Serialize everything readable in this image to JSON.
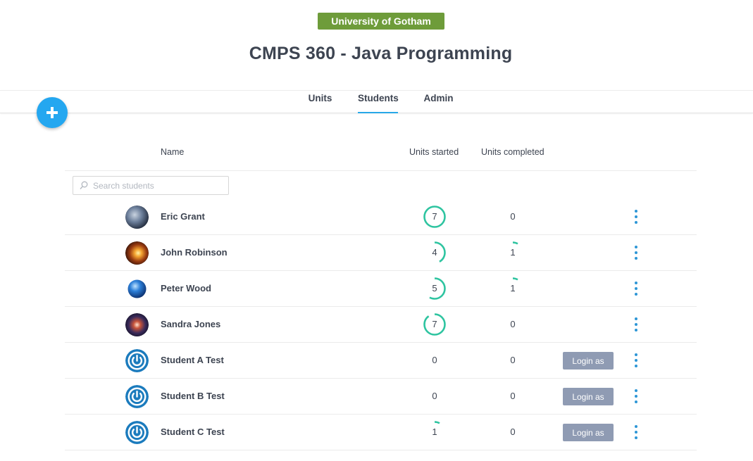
{
  "header": {
    "organization": "University of Gotham",
    "course_title": "CMPS 360 - Java Programming"
  },
  "nav": {
    "tabs": [
      {
        "label": "Units",
        "active": false
      },
      {
        "label": "Students",
        "active": true
      },
      {
        "label": "Admin",
        "active": false
      }
    ]
  },
  "add_button_icon": "plus-icon",
  "table": {
    "columns": {
      "name": "Name",
      "units_started": "Units started",
      "units_completed": "Units completed"
    },
    "search": {
      "placeholder": "Search students",
      "value": ""
    },
    "rows": [
      {
        "name": "Eric Grant",
        "avatar": "earth-planet",
        "units_started": "7",
        "units_completed": "0",
        "started_progress": 1.0,
        "completed_progress": 0,
        "login_label": ""
      },
      {
        "name": "John Robinson",
        "avatar": "solar-flare",
        "units_started": "4",
        "units_completed": "1",
        "started_progress": 0.42,
        "completed_progress": 0.08,
        "login_label": ""
      },
      {
        "name": "Peter Wood",
        "avatar": "blue-globe",
        "units_started": "5",
        "units_completed": "1",
        "started_progress": 0.58,
        "completed_progress": 0.08,
        "login_label": ""
      },
      {
        "name": "Sandra Jones",
        "avatar": "galaxy",
        "units_started": "7",
        "units_completed": "0",
        "started_progress": 0.9,
        "completed_progress": 0,
        "login_label": ""
      },
      {
        "name": "Student A Test",
        "avatar": "power-logo",
        "units_started": "0",
        "units_completed": "0",
        "started_progress": 0,
        "completed_progress": 0,
        "login_label": "Login as"
      },
      {
        "name": "Student B Test",
        "avatar": "power-logo",
        "units_started": "0",
        "units_completed": "0",
        "started_progress": 0,
        "completed_progress": 0,
        "login_label": "Login as"
      },
      {
        "name": "Student C Test",
        "avatar": "power-logo",
        "units_started": "1",
        "units_completed": "0",
        "started_progress": 0.08,
        "completed_progress": 0,
        "login_label": "Login as"
      }
    ]
  },
  "colors": {
    "org_badge": "#6e9c3a",
    "accent_blue": "#24a7f0",
    "progress": "#2ec4a0",
    "login_button": "#8f9bb3",
    "kebab": "#2d96d6"
  }
}
